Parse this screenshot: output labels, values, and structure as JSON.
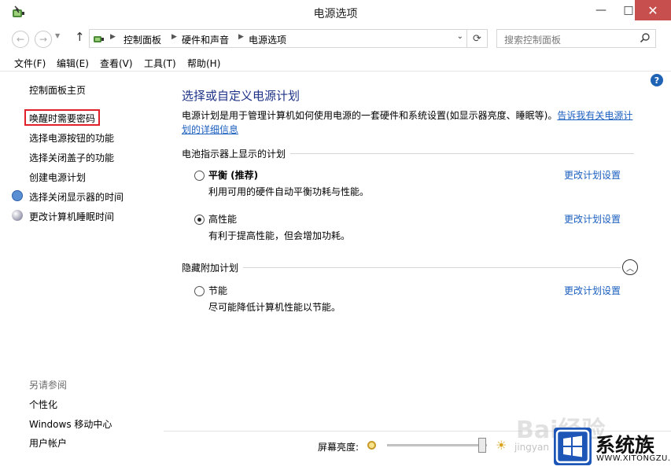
{
  "window": {
    "title": "电源选项",
    "minimize": "—",
    "maximize": "□",
    "close": "✕"
  },
  "navigation": {
    "back": "←",
    "forward": "→",
    "up": "↑",
    "breadcrumbs": [
      "控制面板",
      "硬件和声音",
      "电源选项"
    ],
    "search_placeholder": "搜索控制面板"
  },
  "menu": [
    "文件(F)",
    "编辑(E)",
    "查看(V)",
    "工具(T)",
    "帮助(H)"
  ],
  "help": "?",
  "sidebar": {
    "home": "控制面板主页",
    "links": [
      "唤醒时需要密码",
      "选择电源按钮的功能",
      "选择关闭盖子的功能",
      "创建电源计划",
      "选择关闭显示器的时间",
      "更改计算机睡眠时间"
    ],
    "see_also_title": "另请参阅",
    "see_also": [
      "个性化",
      "Windows 移动中心",
      "用户帐户"
    ]
  },
  "main": {
    "title": "选择或自定义电源计划",
    "description": "电源计划是用于管理计算机如何使用电源的一套硬件和系统设置(如显示器亮度、睡眠等)。",
    "description_link": "告诉我有关电源计划的详细信息",
    "battery_section": "电池指示器上显示的计划",
    "hidden_section": "隐藏附加计划",
    "plans": [
      {
        "name": "平衡 (推荐)",
        "desc": "利用可用的硬件自动平衡功耗与性能。",
        "link": "更改计划设置",
        "selected": false
      },
      {
        "name": "高性能",
        "desc": "有利于提高性能，但会增加功耗。",
        "link": "更改计划设置",
        "selected": true
      },
      {
        "name": "节能",
        "desc": "尽可能降低计算机性能以节能。",
        "link": "更改计划设置",
        "selected": false
      }
    ]
  },
  "brightness": {
    "label": "屏幕亮度:",
    "level_percent": 95
  },
  "watermark": {
    "baidu": "Bai经验",
    "jingyan": "jingyan",
    "site_name": "系统族",
    "site_url": "WWW.XITONGZU.COM"
  },
  "colors": {
    "accent_title": "#1e3287",
    "link": "#1b5fbf",
    "highlight_box": "#e0202a",
    "close_button": "#c7504f"
  }
}
